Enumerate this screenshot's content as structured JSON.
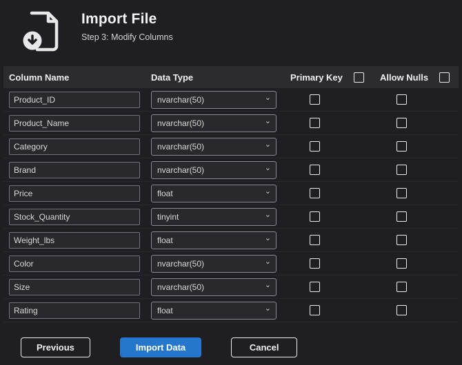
{
  "header": {
    "title": "Import File",
    "subtitle": "Step 3: Modify Columns",
    "icon": "import-file-icon"
  },
  "table": {
    "headers": {
      "column_name": "Column Name",
      "data_type": "Data Type",
      "primary_key": "Primary Key",
      "allow_nulls": "Allow Nulls"
    },
    "header_checkboxes": {
      "primary_key_checked": false,
      "allow_nulls_checked": false
    },
    "rows": [
      {
        "name": "Product_ID",
        "type": "nvarchar(50)",
        "primary_key": false,
        "allow_nulls": false
      },
      {
        "name": "Product_Name",
        "type": "nvarchar(50)",
        "primary_key": false,
        "allow_nulls": false
      },
      {
        "name": "Category",
        "type": "nvarchar(50)",
        "primary_key": false,
        "allow_nulls": false
      },
      {
        "name": "Brand",
        "type": "nvarchar(50)",
        "primary_key": false,
        "allow_nulls": false
      },
      {
        "name": "Price",
        "type": "float",
        "primary_key": false,
        "allow_nulls": false
      },
      {
        "name": "Stock_Quantity",
        "type": "tinyint",
        "primary_key": false,
        "allow_nulls": false
      },
      {
        "name": "Weight_lbs",
        "type": "float",
        "primary_key": false,
        "allow_nulls": false
      },
      {
        "name": "Color",
        "type": "nvarchar(50)",
        "primary_key": false,
        "allow_nulls": false
      },
      {
        "name": "Size",
        "type": "nvarchar(50)",
        "primary_key": false,
        "allow_nulls": false
      },
      {
        "name": "Rating",
        "type": "float",
        "primary_key": false,
        "allow_nulls": false
      }
    ],
    "chevron_glyph": "⌄"
  },
  "footer": {
    "previous_label": "Previous",
    "import_label": "Import Data",
    "cancel_label": "Cancel"
  },
  "colors": {
    "accent": "#2577ce",
    "background": "#1f1f23",
    "header_strip": "#2b2b30"
  }
}
